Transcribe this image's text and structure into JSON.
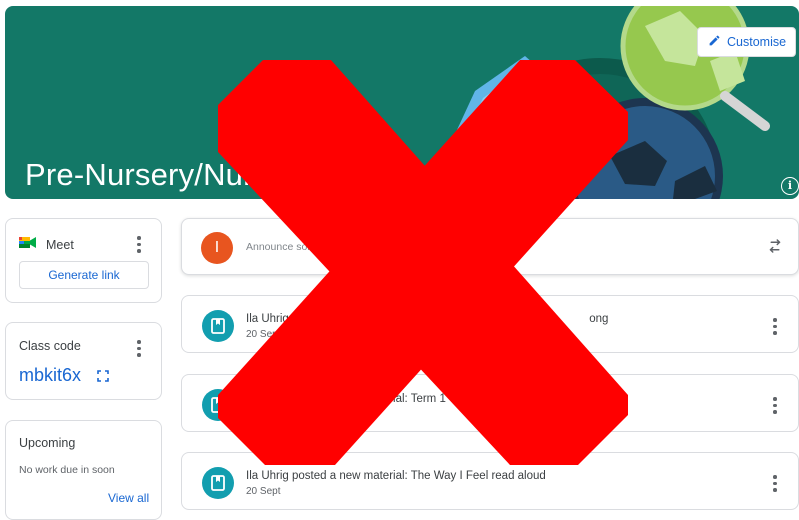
{
  "banner": {
    "title": "Pre-Nursery/Nursery",
    "customise_label": "Customise",
    "info_glyph": "i",
    "background_color": "#137867"
  },
  "meet": {
    "label": "Meet",
    "generate_link_label": "Generate link"
  },
  "class_code": {
    "label": "Class code",
    "value": "mbkit6x"
  },
  "upcoming": {
    "label": "Upcoming",
    "empty_text": "No work due in soon",
    "view_all_label": "View all"
  },
  "announce": {
    "avatar_initial": "I",
    "placeholder": "Announce something to"
  },
  "posts": [
    {
      "title": "Ila Uhrig posted a new material: H",
      "title_tail": "ong",
      "date": "20 Sept"
    },
    {
      "title": "Ila Uhrig posted a new material: Term 1 Week 5",
      "date": ""
    },
    {
      "title": "Ila Uhrig posted a new material: The Way I Feel read aloud",
      "date": "20 Sept"
    }
  ],
  "colors": {
    "accent_blue": "#1967d2",
    "material_icon_bg": "#129eaf",
    "avatar_bg": "#e8551f",
    "overlay_red": "#ff0000"
  },
  "icons": {
    "customise": "pencil-icon",
    "info": "info-icon",
    "meet": "google-meet-icon",
    "more": "more-vert-icon",
    "expand": "fullscreen-icon",
    "repost": "repost-icon",
    "material": "book-icon"
  }
}
